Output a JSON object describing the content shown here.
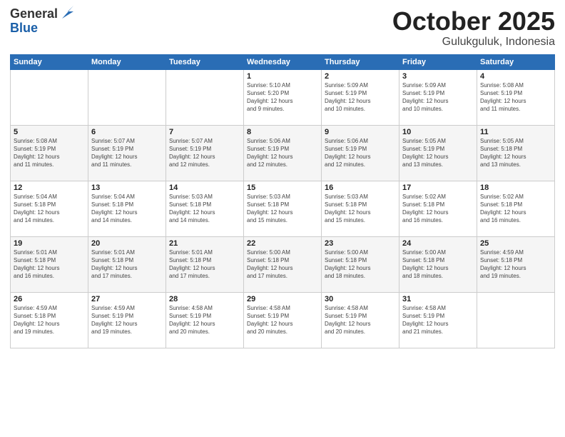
{
  "header": {
    "logo": {
      "general": "General",
      "blue": "Blue"
    },
    "title": "October 2025",
    "location": "Gulukguluk, Indonesia"
  },
  "weekdays": [
    "Sunday",
    "Monday",
    "Tuesday",
    "Wednesday",
    "Thursday",
    "Friday",
    "Saturday"
  ],
  "weeks": [
    [
      {
        "day": "",
        "info": ""
      },
      {
        "day": "",
        "info": ""
      },
      {
        "day": "",
        "info": ""
      },
      {
        "day": "1",
        "info": "Sunrise: 5:10 AM\nSunset: 5:20 PM\nDaylight: 12 hours\nand 9 minutes."
      },
      {
        "day": "2",
        "info": "Sunrise: 5:09 AM\nSunset: 5:19 PM\nDaylight: 12 hours\nand 10 minutes."
      },
      {
        "day": "3",
        "info": "Sunrise: 5:09 AM\nSunset: 5:19 PM\nDaylight: 12 hours\nand 10 minutes."
      },
      {
        "day": "4",
        "info": "Sunrise: 5:08 AM\nSunset: 5:19 PM\nDaylight: 12 hours\nand 11 minutes."
      }
    ],
    [
      {
        "day": "5",
        "info": "Sunrise: 5:08 AM\nSunset: 5:19 PM\nDaylight: 12 hours\nand 11 minutes."
      },
      {
        "day": "6",
        "info": "Sunrise: 5:07 AM\nSunset: 5:19 PM\nDaylight: 12 hours\nand 11 minutes."
      },
      {
        "day": "7",
        "info": "Sunrise: 5:07 AM\nSunset: 5:19 PM\nDaylight: 12 hours\nand 12 minutes."
      },
      {
        "day": "8",
        "info": "Sunrise: 5:06 AM\nSunset: 5:19 PM\nDaylight: 12 hours\nand 12 minutes."
      },
      {
        "day": "9",
        "info": "Sunrise: 5:06 AM\nSunset: 5:19 PM\nDaylight: 12 hours\nand 12 minutes."
      },
      {
        "day": "10",
        "info": "Sunrise: 5:05 AM\nSunset: 5:19 PM\nDaylight: 12 hours\nand 13 minutes."
      },
      {
        "day": "11",
        "info": "Sunrise: 5:05 AM\nSunset: 5:18 PM\nDaylight: 12 hours\nand 13 minutes."
      }
    ],
    [
      {
        "day": "12",
        "info": "Sunrise: 5:04 AM\nSunset: 5:18 PM\nDaylight: 12 hours\nand 14 minutes."
      },
      {
        "day": "13",
        "info": "Sunrise: 5:04 AM\nSunset: 5:18 PM\nDaylight: 12 hours\nand 14 minutes."
      },
      {
        "day": "14",
        "info": "Sunrise: 5:03 AM\nSunset: 5:18 PM\nDaylight: 12 hours\nand 14 minutes."
      },
      {
        "day": "15",
        "info": "Sunrise: 5:03 AM\nSunset: 5:18 PM\nDaylight: 12 hours\nand 15 minutes."
      },
      {
        "day": "16",
        "info": "Sunrise: 5:03 AM\nSunset: 5:18 PM\nDaylight: 12 hours\nand 15 minutes."
      },
      {
        "day": "17",
        "info": "Sunrise: 5:02 AM\nSunset: 5:18 PM\nDaylight: 12 hours\nand 16 minutes."
      },
      {
        "day": "18",
        "info": "Sunrise: 5:02 AM\nSunset: 5:18 PM\nDaylight: 12 hours\nand 16 minutes."
      }
    ],
    [
      {
        "day": "19",
        "info": "Sunrise: 5:01 AM\nSunset: 5:18 PM\nDaylight: 12 hours\nand 16 minutes."
      },
      {
        "day": "20",
        "info": "Sunrise: 5:01 AM\nSunset: 5:18 PM\nDaylight: 12 hours\nand 17 minutes."
      },
      {
        "day": "21",
        "info": "Sunrise: 5:01 AM\nSunset: 5:18 PM\nDaylight: 12 hours\nand 17 minutes."
      },
      {
        "day": "22",
        "info": "Sunrise: 5:00 AM\nSunset: 5:18 PM\nDaylight: 12 hours\nand 17 minutes."
      },
      {
        "day": "23",
        "info": "Sunrise: 5:00 AM\nSunset: 5:18 PM\nDaylight: 12 hours\nand 18 minutes."
      },
      {
        "day": "24",
        "info": "Sunrise: 5:00 AM\nSunset: 5:18 PM\nDaylight: 12 hours\nand 18 minutes."
      },
      {
        "day": "25",
        "info": "Sunrise: 4:59 AM\nSunset: 5:18 PM\nDaylight: 12 hours\nand 19 minutes."
      }
    ],
    [
      {
        "day": "26",
        "info": "Sunrise: 4:59 AM\nSunset: 5:18 PM\nDaylight: 12 hours\nand 19 minutes."
      },
      {
        "day": "27",
        "info": "Sunrise: 4:59 AM\nSunset: 5:19 PM\nDaylight: 12 hours\nand 19 minutes."
      },
      {
        "day": "28",
        "info": "Sunrise: 4:58 AM\nSunset: 5:19 PM\nDaylight: 12 hours\nand 20 minutes."
      },
      {
        "day": "29",
        "info": "Sunrise: 4:58 AM\nSunset: 5:19 PM\nDaylight: 12 hours\nand 20 minutes."
      },
      {
        "day": "30",
        "info": "Sunrise: 4:58 AM\nSunset: 5:19 PM\nDaylight: 12 hours\nand 20 minutes."
      },
      {
        "day": "31",
        "info": "Sunrise: 4:58 AM\nSunset: 5:19 PM\nDaylight: 12 hours\nand 21 minutes."
      },
      {
        "day": "",
        "info": ""
      }
    ]
  ]
}
